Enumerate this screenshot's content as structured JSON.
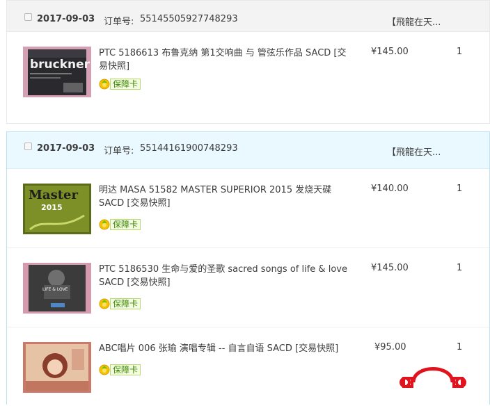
{
  "orders": [
    {
      "date": "2017-09-03",
      "order_no_label": "订单号:",
      "order_no": "55145505927748293",
      "shop": "【飛龍在天...",
      "items": [
        {
          "title": "PTC 5186613 布鲁克纳 第1交响曲 与 管弦乐作品 SACD [交易快照]",
          "price": "¥145.00",
          "qty": "1",
          "badge": "保障卡",
          "cover_text": "bruckner"
        }
      ]
    },
    {
      "date": "2017-09-03",
      "order_no_label": "订单号:",
      "order_no": "55144161900748293",
      "shop": "【飛龍在天...",
      "items": [
        {
          "title": "明达 MASA 51582 MASTER SUPERIOR 2015 发烧天碟 SACD [交易快照]",
          "price": "¥140.00",
          "qty": "1",
          "badge": "保障卡",
          "cover_text": "Master",
          "cover_year": "2015"
        },
        {
          "title": "PTC 5186530 生命与爱的圣歌 sacred songs of life & love SACD [交易快照]",
          "price": "¥145.00",
          "qty": "1",
          "badge": "保障卡",
          "cover_text": "LIFE & LOVE"
        },
        {
          "title": "ABC唱片 006 张瑜 演唱专辑 -- 自言自语 SACD [交易快照]",
          "price": "¥95.00",
          "qty": "1",
          "badge": "保障卡"
        }
      ]
    }
  ],
  "colors": {
    "accent_logo": "#e0141e",
    "badge_green": "#3d8a00",
    "selected_head": "#eaf8ff"
  },
  "icons": {
    "checkbox": "checkbox-icon",
    "badge": "guarantee-coin-icon",
    "watermark": "headphones-logo-icon"
  }
}
